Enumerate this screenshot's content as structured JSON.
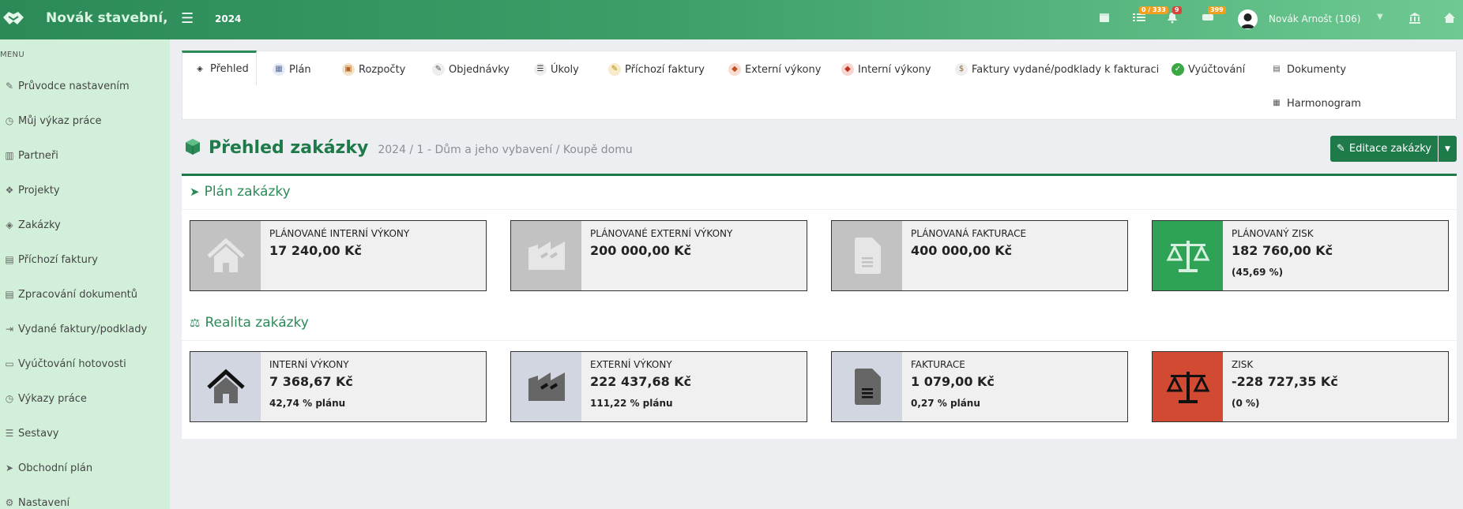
{
  "header": {
    "brand": "Novák stavební,",
    "year": "2024",
    "badges": {
      "tasks": "0 / 333",
      "notifications": "9",
      "messages": "399"
    },
    "user": "Novák Arnošt (106)"
  },
  "sidebar": {
    "menu_label": "MENU",
    "items": [
      {
        "label": "Průvodce nastavením",
        "icon": "pencil-icon"
      },
      {
        "label": "Můj výkaz práce",
        "icon": "clock-icon"
      },
      {
        "label": "Partneři",
        "icon": "building-icon"
      },
      {
        "label": "Projekty",
        "icon": "cubes-icon"
      },
      {
        "label": "Zakázky",
        "icon": "cube-icon"
      },
      {
        "label": "Příchozí faktury",
        "icon": "file-icon"
      },
      {
        "label": "Zpracování dokumentů",
        "icon": "file-text-icon"
      },
      {
        "label": "Vydané faktury/podklady",
        "icon": "file-export-icon"
      },
      {
        "label": "Vyúčtování hotovosti",
        "icon": "money-icon"
      },
      {
        "label": "Výkazy práce",
        "icon": "clock-icon"
      },
      {
        "label": "Sestavy",
        "icon": "list-icon"
      },
      {
        "label": "Obchodní plán",
        "icon": "paper-plane-icon"
      },
      {
        "label": "Nastavení",
        "icon": "gears-icon"
      }
    ]
  },
  "tabs": [
    {
      "label": "Přehled",
      "icon": "cube-icon"
    },
    {
      "label": "Plán",
      "icon": "calendar-icon"
    },
    {
      "label": "Rozpočty",
      "icon": "budget-icon"
    },
    {
      "label": "Objednávky",
      "icon": "order-icon"
    },
    {
      "label": "Úkoly",
      "icon": "list-icon"
    },
    {
      "label": "Příchozí faktury",
      "icon": "invoice-icon"
    },
    {
      "label": "Externí výkony",
      "icon": "external-icon"
    },
    {
      "label": "Interní výkony",
      "icon": "internal-icon"
    },
    {
      "label": "Faktury vydané/podklady k fakturaci",
      "icon": "invoice-out-icon"
    },
    {
      "label": "Vyúčtování",
      "icon": "check-icon"
    },
    {
      "label": "Dokumenty",
      "icon": "document-icon"
    },
    {
      "label": "Harmonogram",
      "icon": "calendar-icon"
    }
  ],
  "page": {
    "title": "Přehled zakázky",
    "breadcrumb": "2024 / 1 - Dům a jeho vybavení / Koupě domu",
    "edit_button": "Editace zakázky"
  },
  "plan": {
    "title": "Plán zakázky",
    "cards": [
      {
        "label": "Plánované interní výkony",
        "value": "17 240,00 Kč",
        "sub": "",
        "icon": "house-icon"
      },
      {
        "label": "Plánované externí výkony",
        "value": "200 000,00 Kč",
        "sub": "",
        "icon": "industry-icon"
      },
      {
        "label": "Plánovaná fakturace",
        "value": "400 000,00 Kč",
        "sub": "",
        "icon": "file-icon"
      },
      {
        "label": "Plánovaný zisk",
        "value": "182 760,00 Kč",
        "sub": "(45,69 %)",
        "icon": "balance-scale-icon"
      }
    ]
  },
  "reality": {
    "title": "Realita zakázky",
    "cards": [
      {
        "label": "Interní výkony",
        "value": "7 368,67 Kč",
        "sub": "42,74 % plánu",
        "icon": "house-icon"
      },
      {
        "label": "Externí výkony",
        "value": "222 437,68 Kč",
        "sub": "111,22 % plánu",
        "icon": "industry-icon"
      },
      {
        "label": "Fakturace",
        "value": "1 079,00 Kč",
        "sub": "0,27 % plánu",
        "icon": "file-icon"
      },
      {
        "label": "Zisk",
        "value": "-228 727,35 Kč",
        "sub": "(0 %)",
        "icon": "balance-scale-icon"
      }
    ]
  },
  "colors": {
    "brand_green": "#1f7a4a",
    "plan_gray": "#c2c2c2",
    "plan_profit_green": "#2ea356",
    "reality_blue_gray": "#d2d6e0",
    "loss_red": "#d24a32"
  }
}
